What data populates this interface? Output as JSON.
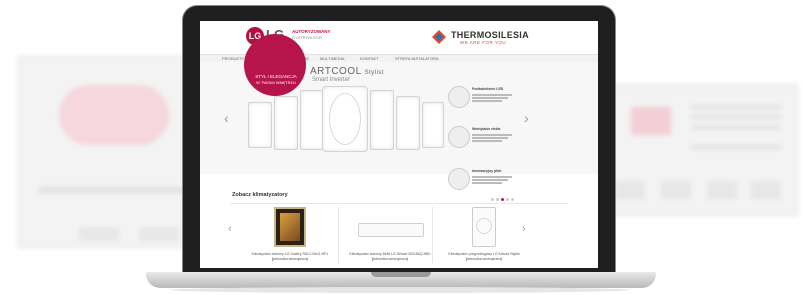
{
  "header": {
    "lg_logo": "LG",
    "lg_brand": "LG",
    "lg_tagline": "Life's Good",
    "authorized_line1": "AUTORYZOWANY",
    "authorized_line2": "DYSTRYBUTOR",
    "partner_name": "THERMOSILESIA",
    "partner_slogan": "WE ARE FOR YOU"
  },
  "nav": {
    "items": [
      "PRODUKTY",
      "WSPARCIE",
      "MULTIMEDIA",
      "KONTAKT",
      "STREFA INSTALATORA"
    ]
  },
  "hero": {
    "badge_line1": "STYL I ELEGANCJA",
    "badge_line2": "W TWOIM WNĘTRZU",
    "title": "ARTCOOL",
    "title_suffix": "Stylist",
    "subtitle": "Smart Inverter",
    "prev": "‹",
    "next": "›",
    "features": [
      {
        "title": "Podświetlenie LED"
      },
      {
        "title": "Wentylator elektr."
      },
      {
        "title": "Innowacyjny pilot"
      }
    ]
  },
  "section": {
    "title": "Zobacz klimatyzatory",
    "prev": "‹",
    "next": "›"
  },
  "products": [
    {
      "caption": "Klimatyzator ścienny LG Gallery RAC12AH1.NP1",
      "note": "[jednostka wewnętrzna]"
    },
    {
      "caption": "Klimatyzator ścienny Multi LG Deluxe MS18AQ.NB0",
      "note": "[jednostka wewnętrzna]"
    },
    {
      "caption": "Klimatyzator przypodłogowy LG Artcool Stylist",
      "note": "[jednostka wewnętrzna]"
    }
  ],
  "colors": {
    "lg_red": "#b0113f",
    "badge_pink": "#b5154a",
    "partner_orange": "#d34b2e"
  }
}
